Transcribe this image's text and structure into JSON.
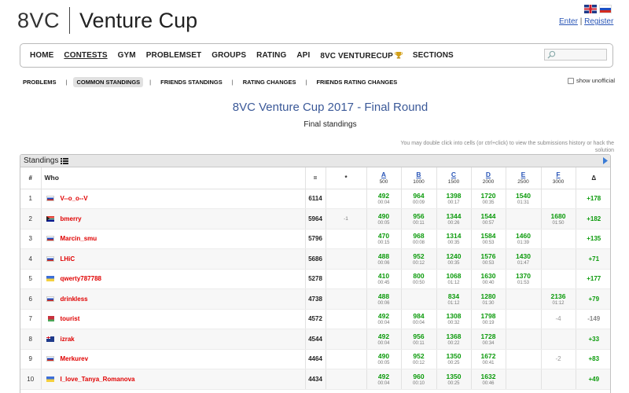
{
  "header": {
    "logo_left": "8VC",
    "logo_title": "Venture Cup",
    "enter_label": "Enter",
    "auth_separator": "|",
    "register_label": "Register"
  },
  "menu": {
    "items": [
      "HOME",
      "CONTESTS",
      "GYM",
      "PROBLEMSET",
      "GROUPS",
      "RATING",
      "API",
      "8VC VENTURECUP",
      "SECTIONS"
    ],
    "active_index": 1
  },
  "submenu": {
    "items": [
      "PROBLEMS",
      "COMMON STANDINGS",
      "FRIENDS STANDINGS",
      "RATING CHANGES",
      "FRIENDS RATING CHANGES"
    ],
    "separator": "|",
    "active_index": 1,
    "show_unofficial_label": "show unofficial"
  },
  "contest": {
    "title": "8VC Venture Cup 2017 - Final Round",
    "subtitle": "Final standings",
    "hint": "You may double click into cells (or ctrl+click) to view the submissions history or hack the solution"
  },
  "standings": {
    "panel_title": "Standings",
    "headers": {
      "rank": "#",
      "who": "Who",
      "penalty": "=",
      "hacks": "*",
      "delta": "Δ"
    },
    "problems": [
      {
        "letter": "A",
        "points": "500"
      },
      {
        "letter": "B",
        "points": "1000"
      },
      {
        "letter": "C",
        "points": "1500"
      },
      {
        "letter": "D",
        "points": "2000"
      },
      {
        "letter": "E",
        "points": "2500"
      },
      {
        "letter": "F",
        "points": "3000"
      }
    ],
    "rows": [
      {
        "rank": "1",
        "flag": "ru",
        "handle": "V--o_o--V",
        "score": "6114",
        "hacks": "",
        "cells": [
          {
            "v": "492",
            "t": "00:04"
          },
          {
            "v": "964",
            "t": "00:09"
          },
          {
            "v": "1398",
            "t": "00:17"
          },
          {
            "v": "1720",
            "t": "00:35"
          },
          {
            "v": "1540",
            "t": "01:31"
          },
          {
            "v": "",
            "t": ""
          }
        ],
        "delta": "+178"
      },
      {
        "rank": "2",
        "flag": "za",
        "handle": "bmerry",
        "score": "5964",
        "hacks": "-1",
        "cells": [
          {
            "v": "490",
            "t": "00:05"
          },
          {
            "v": "956",
            "t": "00:11"
          },
          {
            "v": "1344",
            "t": "00:26"
          },
          {
            "v": "1544",
            "t": "00:57"
          },
          {
            "v": "",
            "t": ""
          },
          {
            "v": "1680",
            "t": "01:50"
          }
        ],
        "delta": "+182"
      },
      {
        "rank": "3",
        "flag": "ru",
        "handle": "Marcin_smu",
        "score": "5796",
        "hacks": "",
        "cells": [
          {
            "v": "470",
            "t": "00:15"
          },
          {
            "v": "968",
            "t": "00:08"
          },
          {
            "v": "1314",
            "t": "00:35"
          },
          {
            "v": "1584",
            "t": "00:53"
          },
          {
            "v": "1460",
            "t": "01:39"
          },
          {
            "v": "",
            "t": ""
          }
        ],
        "delta": "+135"
      },
      {
        "rank": "4",
        "flag": "ru",
        "handle": "LHiC",
        "score": "5686",
        "hacks": "",
        "cells": [
          {
            "v": "488",
            "t": "00:06"
          },
          {
            "v": "952",
            "t": "00:12"
          },
          {
            "v": "1240",
            "t": "00:35"
          },
          {
            "v": "1576",
            "t": "00:53"
          },
          {
            "v": "1430",
            "t": "01:47"
          },
          {
            "v": "",
            "t": ""
          }
        ],
        "delta": "+71"
      },
      {
        "rank": "5",
        "flag": "ua",
        "handle": "qwerty787788",
        "score": "5278",
        "hacks": "",
        "cells": [
          {
            "v": "410",
            "t": "00:45"
          },
          {
            "v": "800",
            "t": "00:50"
          },
          {
            "v": "1068",
            "t": "01:12"
          },
          {
            "v": "1630",
            "t": "00:40"
          },
          {
            "v": "1370",
            "t": "01:53"
          },
          {
            "v": "",
            "t": ""
          }
        ],
        "delta": "+177"
      },
      {
        "rank": "6",
        "flag": "ru",
        "handle": "drinkless",
        "score": "4738",
        "hacks": "",
        "cells": [
          {
            "v": "488",
            "t": "00:06"
          },
          {
            "v": "",
            "t": ""
          },
          {
            "v": "834",
            "t": "01:12"
          },
          {
            "v": "1280",
            "t": "01:30"
          },
          {
            "v": "",
            "t": ""
          },
          {
            "v": "2136",
            "t": "01:12"
          }
        ],
        "delta": "+79"
      },
      {
        "rank": "7",
        "flag": "by",
        "handle": "tourist",
        "score": "4572",
        "hacks": "",
        "cells": [
          {
            "v": "492",
            "t": "00:04"
          },
          {
            "v": "984",
            "t": "00:04"
          },
          {
            "v": "1308",
            "t": "00:32"
          },
          {
            "v": "1798",
            "t": "00:19"
          },
          {
            "v": "",
            "t": ""
          },
          {
            "v": "-4",
            "t": "",
            "rejected": true
          }
        ],
        "delta": "-149"
      },
      {
        "rank": "8",
        "flag": "au",
        "handle": "izrak",
        "score": "4544",
        "hacks": "",
        "cells": [
          {
            "v": "492",
            "t": "00:04"
          },
          {
            "v": "956",
            "t": "00:11"
          },
          {
            "v": "1368",
            "t": "00:22"
          },
          {
            "v": "1728",
            "t": "00:34"
          },
          {
            "v": "",
            "t": ""
          },
          {
            "v": "",
            "t": ""
          }
        ],
        "delta": "+33"
      },
      {
        "rank": "9",
        "flag": "ru",
        "handle": "Merkurev",
        "score": "4464",
        "hacks": "",
        "cells": [
          {
            "v": "490",
            "t": "00:05"
          },
          {
            "v": "952",
            "t": "00:12"
          },
          {
            "v": "1350",
            "t": "00:25"
          },
          {
            "v": "1672",
            "t": "00:41"
          },
          {
            "v": "",
            "t": ""
          },
          {
            "v": "-2",
            "t": "",
            "rejected": true
          }
        ],
        "delta": "+83"
      },
      {
        "rank": "10",
        "flag": "ua",
        "handle": "I_love_Tanya_Romanova",
        "score": "4434",
        "hacks": "",
        "cells": [
          {
            "v": "492",
            "t": "00:04"
          },
          {
            "v": "960",
            "t": "00:10"
          },
          {
            "v": "1350",
            "t": "00:25"
          },
          {
            "v": "1632",
            "t": "00:46"
          },
          {
            "v": "",
            "t": ""
          },
          {
            "v": "",
            "t": ""
          }
        ],
        "delta": "+49"
      }
    ]
  }
}
